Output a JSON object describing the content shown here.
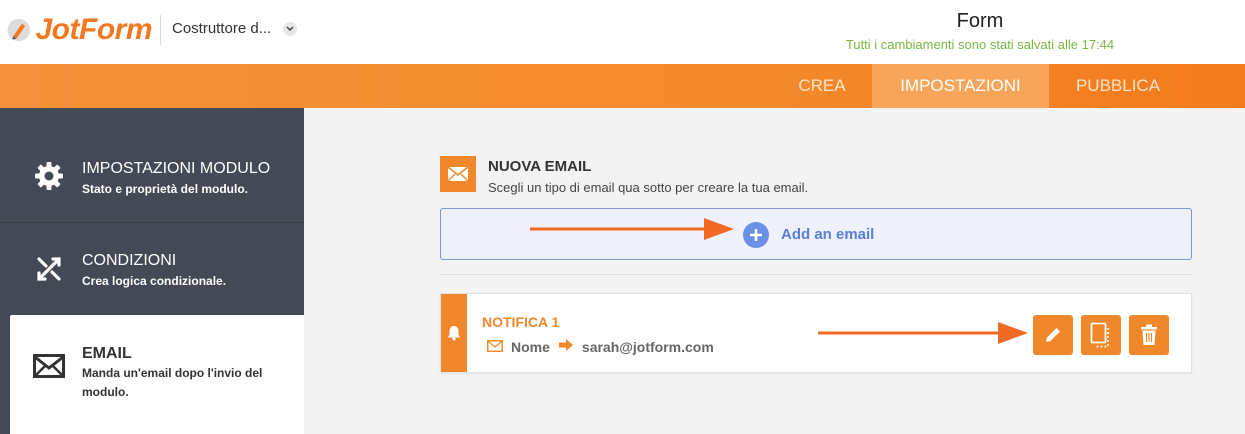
{
  "header": {
    "logo_text": "JotForm",
    "builder_label": "Costruttore d...",
    "form_title": "Form",
    "save_status": "Tutti i cambiamenti sono stati salvati alle 17:44"
  },
  "nav": {
    "tabs": [
      {
        "label": "CREA",
        "active": false
      },
      {
        "label": "IMPOSTAZIONI",
        "active": true
      },
      {
        "label": "PUBBLICA",
        "active": false
      }
    ]
  },
  "sidebar": {
    "items": [
      {
        "title": "IMPOSTAZIONI MODULO",
        "subtitle": "Stato e proprietà del modulo.",
        "icon": "gear-icon"
      },
      {
        "title": "CONDIZIONI",
        "subtitle": "Crea logica condizionale.",
        "icon": "conditions-icon"
      },
      {
        "title": "EMAIL",
        "subtitle": "Manda un'email dopo l'invio del modulo.",
        "subtitle_lines": [
          "Manda un'email dopo l'invio del",
          "modulo."
        ],
        "icon": "envelope-icon",
        "active": true
      }
    ]
  },
  "main": {
    "new_email": {
      "title": "NUOVA EMAIL",
      "subtitle": "Scegli un tipo di email qua sotto per creare la tua email."
    },
    "add_email_label": "Add an email",
    "notification": {
      "title": "NOTIFICA 1",
      "from": "Nome",
      "to": "sarah@jotform.com"
    }
  },
  "colors": {
    "accent": "#f0872a",
    "sidebar": "#434a55",
    "save_status": "#7cb342",
    "add_link": "#5b7fd6"
  }
}
